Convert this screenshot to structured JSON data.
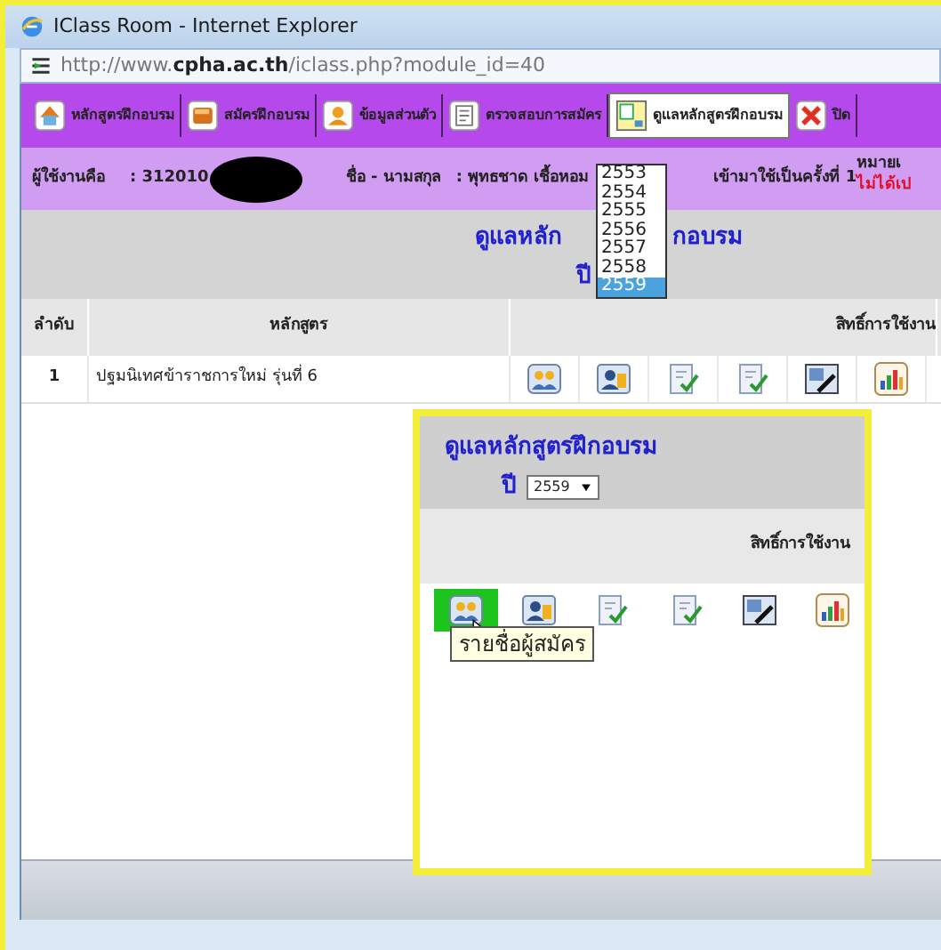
{
  "window": {
    "title": "IClass Room - Internet Explorer",
    "url": "http://www.**cpha.ac.th**/iclass.php?module_id=40"
  },
  "menu": [
    {
      "label": "หลักสูตรฝึกอบรม",
      "kind": "house",
      "selected": false
    },
    {
      "label": "สมัครฝึกอบรม",
      "kind": "book",
      "selected": false
    },
    {
      "label": "ข้อมูลส่วนตัว",
      "kind": "person",
      "selected": false
    },
    {
      "label": "ตรวจสอบการสมัคร",
      "kind": "document",
      "selected": false
    },
    {
      "label": "ดูแลหลักสูตรฝึกอบรม",
      "kind": "board",
      "selected": true
    },
    {
      "label": "ปิด",
      "kind": "close",
      "selected": false
    }
  ],
  "user_bar": {
    "user_label": "ผู้ใช้งานคือ",
    "user_id": ": 312010",
    "name_label": "ชื่อ - นามสกุล",
    "name_value": ": พุทธชาด เชื้อหอม",
    "visits": "เข้ามาใช้เป็นครั้งที่ 1",
    "note_1": "หมายเ",
    "note_2": "ไม่ได้เป"
  },
  "page": {
    "title_start": "ดูแลหลัก",
    "title_end": "กอบรม",
    "year_label": "ปี"
  },
  "year_list": [
    {
      "label": "2553",
      "selected": false
    },
    {
      "label": "2554",
      "selected": false
    },
    {
      "label": "2555",
      "selected": false
    },
    {
      "label": "2556",
      "selected": false
    },
    {
      "label": "2557",
      "selected": false
    },
    {
      "label": "2558",
      "selected": false
    },
    {
      "label": "2559",
      "selected": true
    }
  ],
  "table": {
    "columns": [
      "ลำดับ",
      "หลักสูตร",
      "สิทธิ์การใช้งาน"
    ],
    "rows": [
      {
        "no": "1",
        "course": "ปฐมนิเทศข้าราชการใหม่ รุ่นที่ 6",
        "actions": [
          {
            "kind": "group",
            "hovered": false
          },
          {
            "kind": "card",
            "hovered": false
          },
          {
            "kind": "check",
            "hovered": false
          },
          {
            "kind": "check",
            "hovered": false
          },
          {
            "kind": "edit",
            "hovered": false
          },
          {
            "kind": "chart",
            "hovered": false
          }
        ]
      }
    ]
  },
  "inset": {
    "title": "ดูแลหลักสูตรฝึกอบรม",
    "year_label": "ปี",
    "year_value": "2559",
    "column": "สิทธิ์การใช้งาน",
    "actions": [
      {
        "kind": "group",
        "hovered": true
      },
      {
        "kind": "card",
        "hovered": false
      },
      {
        "kind": "check",
        "hovered": false
      },
      {
        "kind": "check",
        "hovered": false
      },
      {
        "kind": "edit",
        "hovered": false
      },
      {
        "kind": "chart",
        "hovered": false
      }
    ],
    "tooltip": "รายชื่อผู้สมัคร"
  }
}
